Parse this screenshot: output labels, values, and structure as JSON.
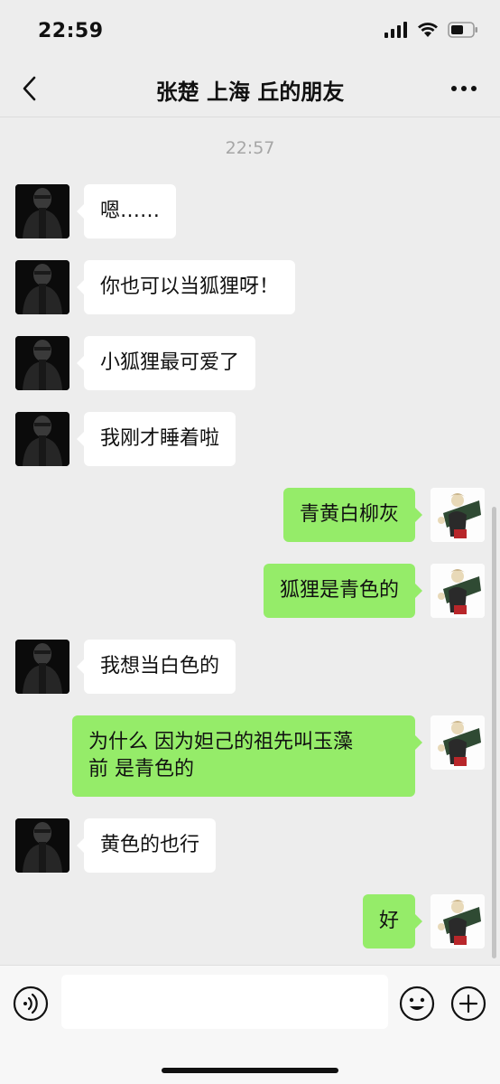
{
  "status_bar": {
    "time": "22:59",
    "icons": [
      "cellular-signal-icon",
      "wifi-icon",
      "battery-icon"
    ]
  },
  "header": {
    "title": "张楚 上海 丘的朋友",
    "back_icon": "chevron-left-icon",
    "more_icon": "more-dots-icon"
  },
  "chat": {
    "timestamp": "22:57",
    "messages": [
      {
        "side": "in",
        "text": "嗯……"
      },
      {
        "side": "in",
        "text": "你也可以当狐狸呀！"
      },
      {
        "side": "in",
        "text": "小狐狸最可爱了"
      },
      {
        "side": "in",
        "text": " 我刚才睡着啦"
      },
      {
        "side": "out",
        "text": "青黄白柳灰"
      },
      {
        "side": "out",
        "text": "狐狸是青色的"
      },
      {
        "side": "in",
        "text": "我想当白色的"
      },
      {
        "side": "out",
        "line1": "为什么 因为妲己的祖先叫玉藻",
        "line2": "前 是青色的"
      },
      {
        "side": "in",
        "text": "黄色的也行"
      },
      {
        "side": "out",
        "text": "好"
      }
    ]
  },
  "input_bar": {
    "voice_icon": "voice-icon",
    "emoji_icon": "emoji-icon",
    "plus_icon": "plus-icon",
    "input_value": ""
  },
  "colors": {
    "background": "#ededed",
    "outgoing_bubble": "#95ec69",
    "incoming_bubble": "#ffffff",
    "timestamp": "#a6a6a6"
  }
}
